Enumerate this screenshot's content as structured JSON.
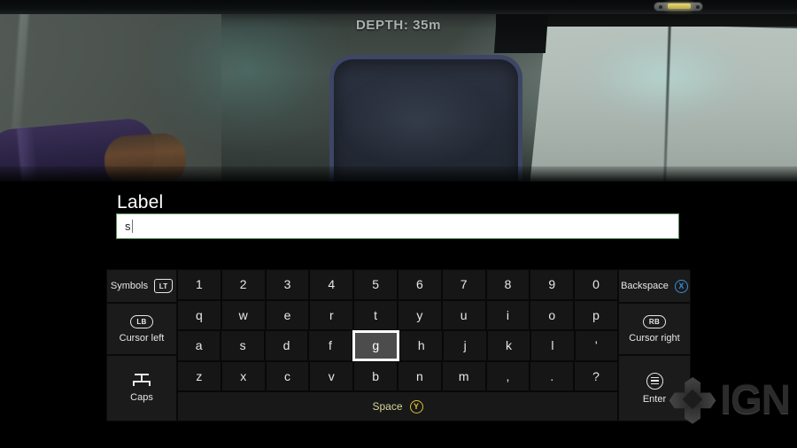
{
  "game": {
    "hud": {
      "depth_label": "DEPTH: 35m"
    },
    "scene_colors": {
      "wall_light": "#b3bdb8",
      "wall_teal_glow": "#58968c",
      "panel_frame": "#3d4664",
      "panel_fill": "#262c38",
      "cylinder_purple": "#2e2648",
      "cylinder_orange": "#6a4a2e",
      "light_bulb": "#bda93f"
    }
  },
  "overlay": {
    "title": "Label",
    "text_field": {
      "value": "s",
      "placeholder": "",
      "border_color": "#5d8f5d",
      "background": "#ffffff"
    }
  },
  "keyboard": {
    "left_keys": [
      {
        "label": "Symbols",
        "badge": "LT",
        "badge_type": "trigger-badge",
        "name": "symbols-key"
      },
      {
        "label": "Cursor left",
        "badge": "LB",
        "badge_type": "bumper-badge",
        "name": "cursor-left-key"
      },
      {
        "label": "Caps",
        "badge": "",
        "badge_type": "caps-glyph",
        "name": "caps-key"
      }
    ],
    "right_keys": [
      {
        "label": "Backspace",
        "badge": "X",
        "badge_type": "x-button-badge",
        "badge_color": "#3b8fd6",
        "name": "backspace-key"
      },
      {
        "label": "Cursor right",
        "badge": "RB",
        "badge_type": "bumper-badge",
        "name": "cursor-right-key"
      },
      {
        "label": "Enter",
        "badge": "",
        "badge_type": "menu-button-badge",
        "name": "enter-key"
      }
    ],
    "rows": [
      {
        "name": "number-row",
        "keys": [
          "1",
          "2",
          "3",
          "4",
          "5",
          "6",
          "7",
          "8",
          "9",
          "0"
        ]
      },
      {
        "name": "qwerty-row",
        "keys": [
          "q",
          "w",
          "e",
          "r",
          "t",
          "y",
          "u",
          "i",
          "o",
          "p"
        ]
      },
      {
        "name": "home-row",
        "keys": [
          "a",
          "s",
          "d",
          "f",
          "g",
          "h",
          "j",
          "k",
          "l",
          "'"
        ]
      },
      {
        "name": "bottom-row",
        "keys": [
          "z",
          "x",
          "c",
          "v",
          "b",
          "n",
          "m",
          ",",
          ".",
          "?"
        ]
      }
    ],
    "selected_key": "g",
    "selected_row_index": 2,
    "selected_key_index": 4,
    "space": {
      "label": "Space",
      "badge": "Y",
      "badge_color": "#d8c034"
    }
  },
  "watermark": {
    "text": "IGN"
  }
}
